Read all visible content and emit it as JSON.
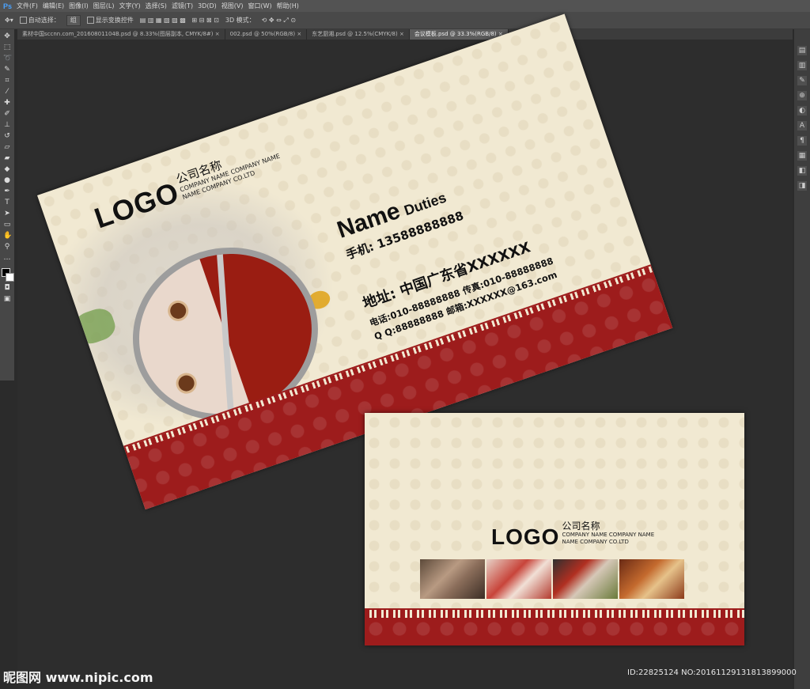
{
  "app": {
    "logo": "Ps",
    "menu": [
      "文件(F)",
      "编辑(E)",
      "图像(I)",
      "图层(L)",
      "文字(Y)",
      "选择(S)",
      "滤镜(T)",
      "3D(D)",
      "视图(V)",
      "窗口(W)",
      "帮助(H)"
    ]
  },
  "options": {
    "auto_select_label": "自动选择：",
    "auto_select_value": "组",
    "show_transform_label": "显示变换控件",
    "mode_3d_label": "3D 模式："
  },
  "tabs": [
    "素材中国sccnn.com_20160801104B.psd @ 8.33%(图层副本, CMYK/8#) ×",
    "002.psd @ 50%(RGB/8) ×",
    "东艺厨湘.psd @ 12.5%(CMYK/8) ×",
    "会议模板.psd @ 33.3%(RGB/8) ×"
  ],
  "card_front": {
    "logo": "LOGO",
    "company_cn": "公司名称",
    "company_en_1": "COMPANY NAME COMPANY NAME",
    "company_en_2": "NAME COMPANY CO.LTD",
    "name": "Name",
    "duties": "Duties",
    "mobile": "手机:  13588888888",
    "address": "地址:  中国广东省XXXXXX",
    "contact_line_1": "电话:010-88888888  传真:010-88888888",
    "contact_line_2": "Q Q:88888888   邮箱:XXXXXX@163.com"
  },
  "card_back": {
    "logo": "LOGO",
    "company_cn": "公司名称",
    "company_en_1": "COMPANY NAME COMPANY NAME",
    "company_en_2": "NAME COMPANY CO.LTD"
  },
  "colors": {
    "card_cream": "#f1e9d2",
    "band_red": "#9d1c1c",
    "ui_dark": "#2b2b2b"
  },
  "watermark": {
    "site": "昵图网 www.nipic.com",
    "id": "ID:22825124 NO:20161129131813899000"
  }
}
